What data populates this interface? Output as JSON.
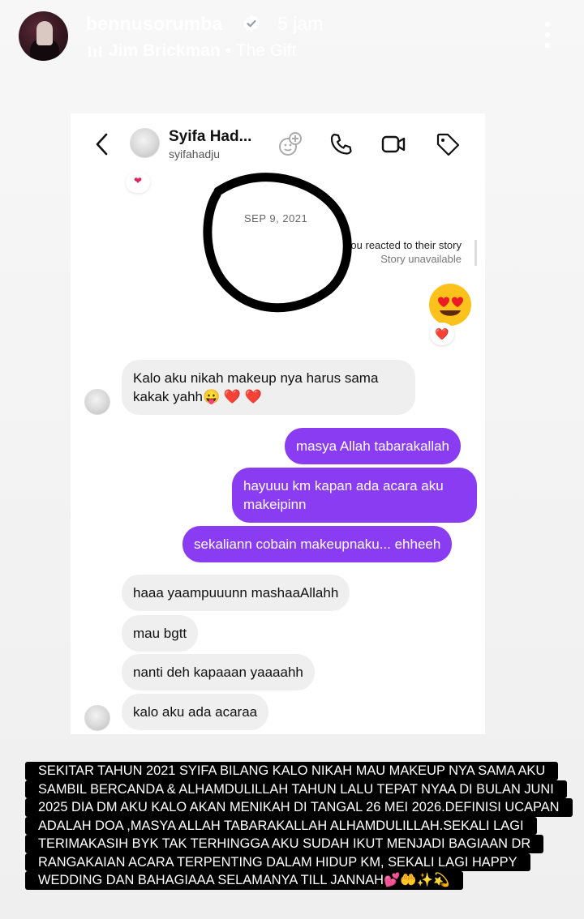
{
  "story": {
    "username": "bennusorumba",
    "time_ago": "5 jam",
    "music_artist": "Jim Brickman",
    "music_separator": "•",
    "music_song": "The Gift",
    "icons": [
      "verified-badge-icon",
      "music-bars-icon",
      "more-vertical-icon"
    ]
  },
  "dm": {
    "contact_name": "Syifa Had...",
    "contact_handle": "syifahadju",
    "date": "SEP 9, 2021",
    "story_reply_line1": "You reacted to their story",
    "story_reply_line2": "Story unavailable",
    "reaction_heart": "❤️",
    "messages": [
      {
        "from": "them",
        "text_line1": "Kalo aku nikah makeup nya harus sama",
        "text_line2": "kakak yahh😛 ❤️ ❤️"
      },
      {
        "from": "me",
        "text": "masya Allah tabarakallah"
      },
      {
        "from": "me",
        "text_line1": "hayuuu km kapan ada acara aku",
        "text_line2": "makeipinn"
      },
      {
        "from": "me",
        "text": "sekaliann cobain makeupnaku... ehheeh"
      },
      {
        "from": "them",
        "text": "haaa yaampuuunn mashaaAllahh"
      },
      {
        "from": "them",
        "text": "mau bgtt"
      },
      {
        "from": "them",
        "text": "nanti deh kapaaan yaaaahh"
      },
      {
        "from": "them",
        "text": "kalo aku ada acaraa"
      }
    ],
    "colors": {
      "outgoing": "#8a3cf2",
      "incoming": "#efefef",
      "heart": "#e0245e"
    }
  },
  "caption": {
    "lines": [
      "SEKITAR TAHUN 2021 SYIFA BILANG KALO NIKAH MAU MAKEUP NYA SAMA AKU",
      "SAMBIL BERCANDA & ALHAMDULILLAH TAHUN  LALU TEPAT  NYAA DI BULAN JUNI",
      "2025 DIA DM AKU KALO AKAN MENIKAH  DI TANGAL  26 MEI 2026.DEFINISI UCAPAN",
      "ADALAH DOA ,MASYA ALLAH TABARAKALLAH ALHAMDULILLAH.SEKALI LAGI",
      "TERIMAKASIH BYK  TAK TERHINGGA AKU SUDAH IKUT MENJADI BAGIAAN DR",
      "RANGAKAIAN ACARA TERPENTING  DALAM HIDUP KM, SEKALI LAGI HAPPY",
      "WEDDING DAN BAHAGIAAA SELAMANYA  TILL JANNAH💕🤲✨💫"
    ]
  }
}
